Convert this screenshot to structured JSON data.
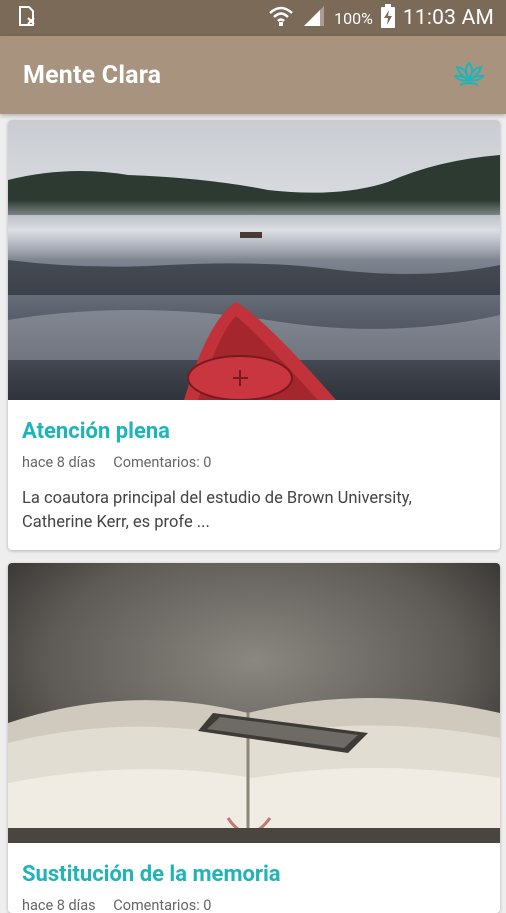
{
  "status_bar": {
    "battery_percent": "100%",
    "time": "11:03 AM"
  },
  "app_bar": {
    "title": "Mente Clara",
    "accent_color": "#1fb5b8",
    "action_icon": "lotus-icon"
  },
  "articles": [
    {
      "title": "Atención plena",
      "date": "hace 8 días",
      "comments": "Comentarios: 0",
      "excerpt": "La coautora principal del estudio de Brown University, Catherine Kerr, es profe ...",
      "image": "kayak-on-misty-lake"
    },
    {
      "title": "Sustitución de la memoria",
      "date": "hace 8 días",
      "comments": "Comentarios: 0",
      "excerpt": "",
      "image": "open-photo-album"
    }
  ]
}
